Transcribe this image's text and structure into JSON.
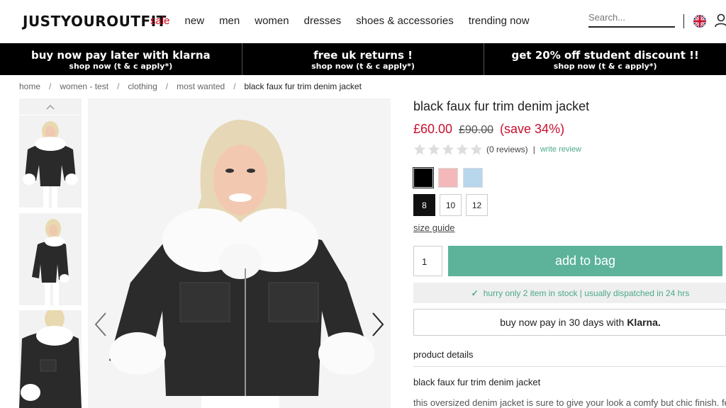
{
  "header": {
    "logo": "JUSTYOUROUTFIT",
    "nav": [
      "sale",
      "new",
      "men",
      "women",
      "dresses",
      "shoes & accessories",
      "trending now"
    ],
    "search_placeholder": "Search..."
  },
  "promos": [
    {
      "title": "buy now pay later with klarna",
      "sub": "shop now (t & c apply*)"
    },
    {
      "title": "free uk returns !",
      "sub": "shop now (t & c apply*)"
    },
    {
      "title": "get 20% off student discount !!",
      "sub": "shop now (t & c apply*)"
    }
  ],
  "breadcrumb": [
    "home",
    "women - test",
    "clothing",
    "most wanted",
    "black faux fur trim denim jacket"
  ],
  "product": {
    "title": "black faux fur trim denim jacket",
    "price_now": "£60.00",
    "price_was": "£90.00",
    "price_save": "(save 34%)",
    "reviews": "(0 reviews)",
    "separator": "|",
    "write_review": "write review",
    "colors": [
      "#000000",
      "#f4b8bb",
      "#b8d6ec"
    ],
    "sizes": [
      "8",
      "10",
      "12"
    ],
    "size_guide": "size guide",
    "quantity": "1",
    "add_to_bag": "add to bag",
    "stock_msg": "hurry only 2 item in stock | usually dispatched in 24 hrs",
    "klarna_text": "buy now pay in 30 days with",
    "klarna_brand": "Klarna.",
    "details_heading": "product details",
    "details_name": "black faux fur trim denim jacket",
    "details_desc": "this oversized denim jacket is sure to give your look a comfy but chic finish. fea"
  },
  "colors": {
    "sale": "#d0021b",
    "accent": "#5cb39a",
    "price": "#c8102e"
  }
}
